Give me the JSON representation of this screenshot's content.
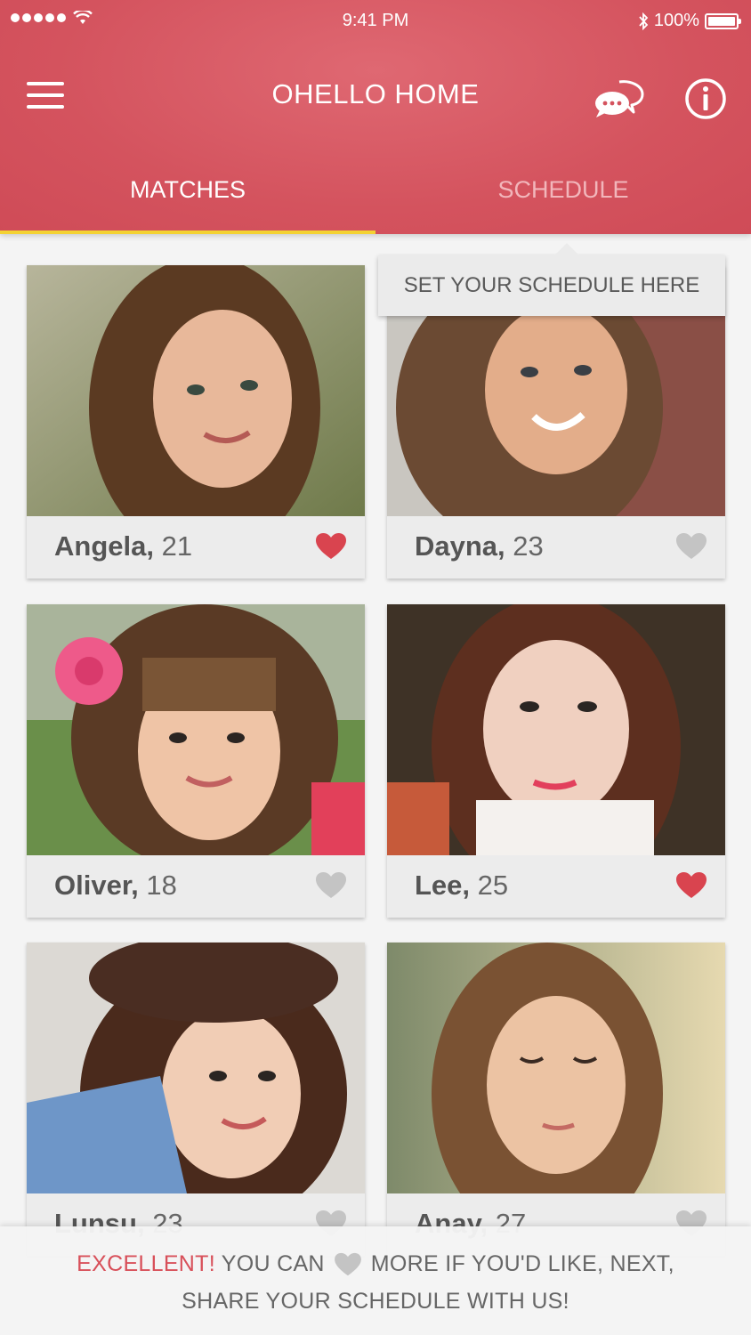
{
  "status_bar": {
    "time": "9:41 PM",
    "battery": "100%",
    "battery_level": 1.0
  },
  "header": {
    "title": "OHELLO HOME",
    "icons": {
      "menu": "menu-icon",
      "chat": "chat-bubbles-icon",
      "info": "info-icon"
    }
  },
  "tabs": [
    {
      "label": "MATCHES",
      "active": true
    },
    {
      "label": "SCHEDULE",
      "active": false
    }
  ],
  "tooltip": {
    "text": "SET YOUR SCHEDULE HERE"
  },
  "matches": [
    {
      "name": "Angela,",
      "age": "21",
      "liked": true
    },
    {
      "name": "Dayna,",
      "age": "23",
      "liked": false
    },
    {
      "name": "Oliver,",
      "age": "18",
      "liked": false
    },
    {
      "name": "Lee,",
      "age": "25",
      "liked": true
    },
    {
      "name": "Lunsu,",
      "age": "23",
      "liked": false
    },
    {
      "name": "Anay,",
      "age": "27",
      "liked": false
    }
  ],
  "banner": {
    "highlight": "EXCELLENT!",
    "line1_a": "YOU CAN",
    "line1_b": "MORE IF YOU'D LIKE, NEXT,",
    "line2": "SHARE YOUR SCHEDULE WITH US!"
  },
  "colors": {
    "brand": "#d4535e",
    "tab_indicator": "#f3d233",
    "heart_liked": "#d9444f",
    "heart_unliked": "#c4c4c4"
  }
}
